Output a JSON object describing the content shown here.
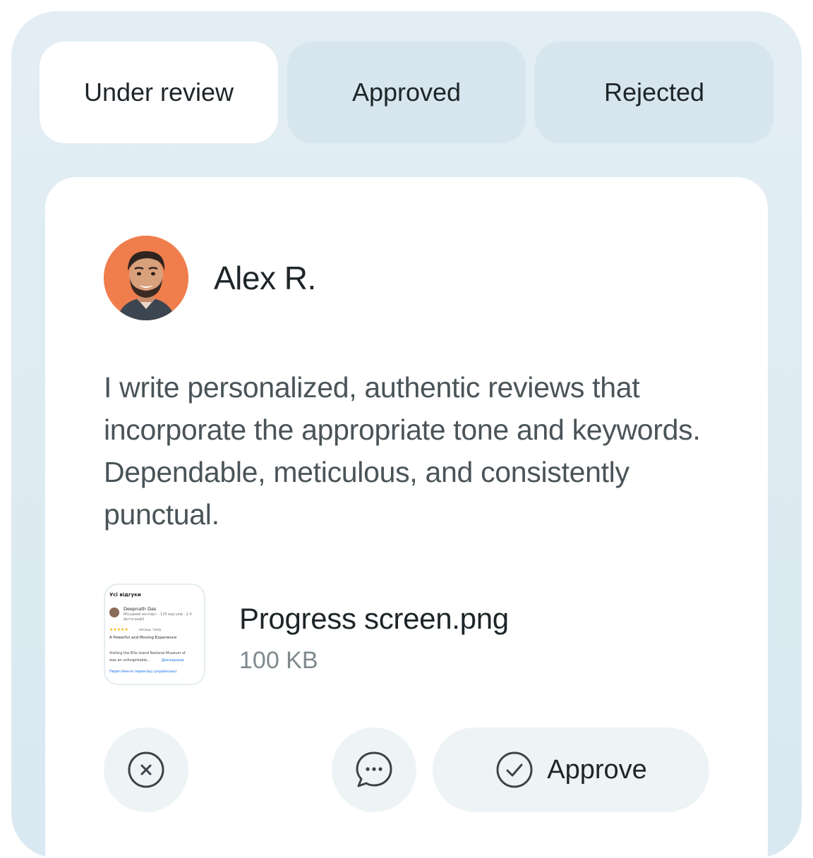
{
  "tabs": [
    {
      "label": "Under review",
      "active": true
    },
    {
      "label": "Approved",
      "active": false
    },
    {
      "label": "Rejected",
      "active": false
    }
  ],
  "review": {
    "author_name": "Alex R.",
    "text": "I write personalized, authentic reviews that incorporate the appropriate tone and keywords. Dependable, meticulous, and consistently punctual.",
    "attachment": {
      "file_name": "Progress screen.png",
      "file_size": "100 KB",
      "thumbnail": {
        "heading": "Усі відгуки",
        "reviewer": "Deepnath Das",
        "reviewer_meta": "Місцевий експерт · 129 відгуків · 2 4",
        "reviewer_meta2": "фотографії",
        "rating_stars": "★★★★★",
        "rating_when": "місяць тому",
        "review_title": "A Powerful and Moving Experience",
        "review_line1": "Visiting the Ellis Island National Museum of",
        "review_line2": "was an unforgettable...",
        "more_link": "Докладніше",
        "translate_link": "Перегляньте переклад (українська)"
      }
    }
  },
  "actions": {
    "reject_icon": "close-circle-icon",
    "comment_icon": "chat-bubble-icon",
    "approve_icon": "check-circle-icon",
    "approve_label": "Approve"
  },
  "colors": {
    "frame_bg": "#dde9f1",
    "inactive_tab_bg": "#d6e5ee",
    "avatar_bg": "#f07e4d",
    "button_bg": "#eef4f5",
    "text_primary": "#1e2528",
    "text_secondary": "#4a5458"
  }
}
